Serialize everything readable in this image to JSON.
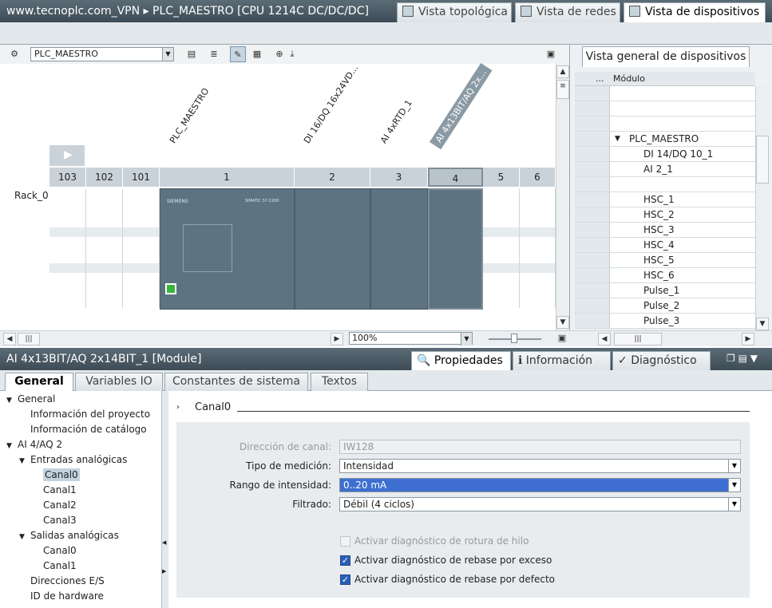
{
  "window": {
    "title": "www.tecnoplc.com_VPN  ▸  PLC_MAESTRO [CPU 1214C DC/DC/DC]"
  },
  "view_tabs": {
    "topology": "Vista topológica",
    "network": "Vista de redes",
    "device": "Vista de dispositivos"
  },
  "toolbar": {
    "device_select": "PLC_MAESTRO",
    "zoom": "100%"
  },
  "canvas": {
    "module_labels": [
      "PLC_MAESTRO",
      "DI 16/DQ 16x24VD...",
      "AI 4xRTD_1",
      "AI 4x13BIT/AQ 2x..."
    ],
    "slots": [
      "103",
      "102",
      "101",
      "1",
      "2",
      "3",
      "4",
      "5",
      "6"
    ],
    "rack_label": "Rack_0",
    "module_texts": {
      "brand": "SIEMENS",
      "cpu_model": "SIMATIC S7-1200"
    }
  },
  "overview": {
    "tab_label": "Vista general de dispositivos",
    "col_dots": "...",
    "col_module": "Módulo",
    "rows": [
      "",
      "",
      "",
      "PLC_MAESTRO",
      "DI 14/DQ 10_1",
      "AI 2_1",
      "",
      "HSC_1",
      "HSC_2",
      "HSC_3",
      "HSC_4",
      "HSC_5",
      "HSC_6",
      "Pulse_1",
      "Pulse_2",
      "Pulse_3"
    ]
  },
  "inspector": {
    "title": "AI 4x13BIT/AQ 2x14BIT_1 [Module]",
    "tabs": {
      "properties": "Propiedades",
      "info": "Información",
      "diagnostics": "Diagnóstico"
    },
    "subtabs": [
      "General",
      "Variables IO",
      "Constantes de sistema",
      "Textos"
    ]
  },
  "nav": [
    {
      "label": "General",
      "level": 0,
      "expand": "▼"
    },
    {
      "label": "Información del proyecto",
      "level": 1,
      "expand": ""
    },
    {
      "label": "Información de catálogo",
      "level": 1,
      "expand": ""
    },
    {
      "label": "AI 4/AQ 2",
      "level": 0,
      "expand": "▼"
    },
    {
      "label": "Entradas analógicas",
      "level": 1,
      "expand": "▼"
    },
    {
      "label": "Canal0",
      "level": 2,
      "expand": "",
      "selected": true
    },
    {
      "label": "Canal1",
      "level": 2,
      "expand": ""
    },
    {
      "label": "Canal2",
      "level": 2,
      "expand": ""
    },
    {
      "label": "Canal3",
      "level": 2,
      "expand": ""
    },
    {
      "label": "Salidas analógicas",
      "level": 1,
      "expand": "▼"
    },
    {
      "label": "Canal0",
      "level": 2,
      "expand": ""
    },
    {
      "label": "Canal1",
      "level": 2,
      "expand": ""
    },
    {
      "label": "Direcciones E/S",
      "level": 1,
      "expand": ""
    },
    {
      "label": "ID de hardware",
      "level": 1,
      "expand": ""
    }
  ],
  "form": {
    "section": "Canal0",
    "address_label": "Dirección de canal:",
    "address_value": "IW128",
    "meas_label": "Tipo de medición:",
    "meas_value": "Intensidad",
    "range_label": "Rango de intensidad:",
    "range_value": "0..20 mA",
    "filter_label": "Filtrado:",
    "filter_value": "Débil (4 ciclos)",
    "chk_wirebreak": "Activar diagnóstico de rotura de hilo",
    "chk_overflow": "Activar diagnóstico de rebase por exceso",
    "chk_underflow": "Activar diagnóstico de rebase por defecto",
    "chk_wirebreak_checked": false,
    "chk_overflow_checked": true,
    "chk_underflow_checked": true
  }
}
